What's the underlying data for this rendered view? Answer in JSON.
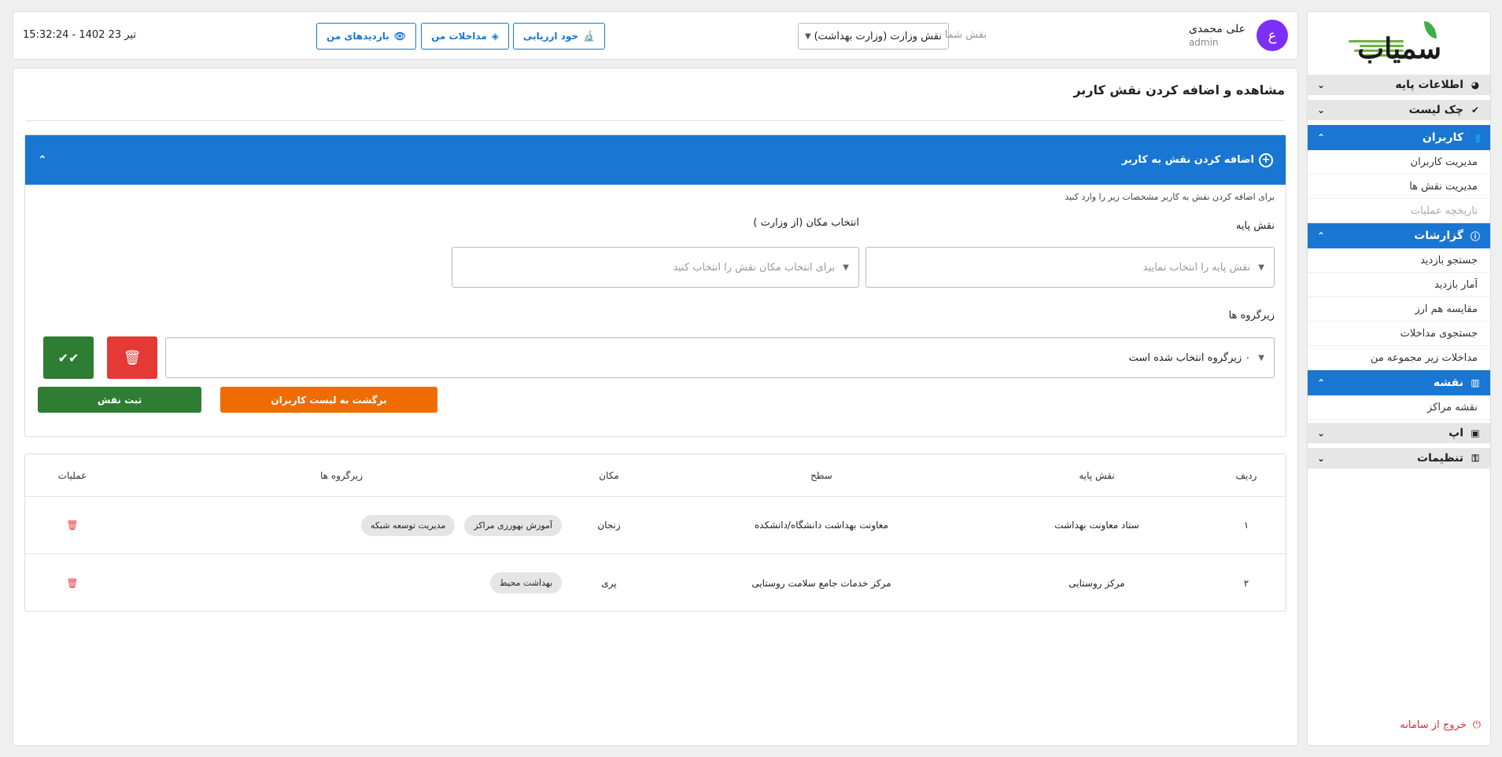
{
  "sidebar": {
    "logo_text": "سمیاب",
    "groups": [
      {
        "label": "اطلاعات پایه",
        "icon": "pie-chart-icon",
        "expanded": false
      },
      {
        "label": "چک لیست",
        "icon": "check-circle-icon",
        "expanded": false
      },
      {
        "label": "کاربران",
        "icon": "users-icon",
        "expanded": true,
        "items": [
          "مدیریت کاربران",
          "مدیریت نقش ها",
          "تاریخچه عملیات"
        ]
      },
      {
        "label": "گزارشات",
        "icon": "alert-circle-icon",
        "expanded": true,
        "items": [
          "جستجو بازدید",
          "آمار بازدید",
          "مقایسه هم ارز",
          "جستجوی مداخلات",
          "مداخلات زیر مجموعه من"
        ]
      },
      {
        "label": "نقشه",
        "icon": "map-icon",
        "expanded": true,
        "items": [
          "نقشه مراکز"
        ]
      },
      {
        "label": "اپ",
        "icon": "app-icon",
        "expanded": false
      },
      {
        "label": "تنظیمات",
        "icon": "key-icon",
        "expanded": false
      }
    ],
    "logout": "خروج از سامانه"
  },
  "header": {
    "user_initial": "ع",
    "user_name": "علی محمدی",
    "user_role": "admin",
    "role_label": "نقش شما",
    "role_value": "نقش وزارت (وزارت بهداشت)",
    "buttons": {
      "self_eval": "خود ارزیابی",
      "interventions": "مداخلات من",
      "visits": "بازدیدهای من"
    },
    "datetime": "15:32:24 - 1402 تیر 23"
  },
  "page": {
    "title": "مشاهده و اضافه کردن نقش کاربر",
    "panel": {
      "title": "اضافه کردن نقش به کاربر",
      "hint": "برای اضافه کردن نقش به کاربر مشخصات زیر را وارد کنید",
      "base_role_label": "نقش پایه",
      "base_role_placeholder": "نقش پایه را انتخاب نمایید",
      "location_label": "انتخاب مکان (از وزارت )",
      "location_placeholder": "برای انتخاب مکان نقش را انتخاب کنید",
      "subgroups_label": "زیرگروه ها",
      "subgroups_value": "۰ زیرگروه انتخاب شده است",
      "back_button": "برگشت به لیست کاربران",
      "submit_button": "ثبت نقش"
    },
    "table": {
      "headers": {
        "index": "ردیف",
        "base_role": "نقش پایه",
        "level": "سطح",
        "location": "مکان",
        "subgroups": "زیرگروه ها",
        "actions": "عملیات"
      },
      "rows": [
        {
          "index": "۱",
          "base_role": "ستاد معاونت بهداشت",
          "level": "معاونت بهداشت دانشگاه/دانشکده",
          "location": "زنجان",
          "subgroups": [
            "آموزش بهورزی مراکز",
            "مدیریت توسعه شبکه"
          ]
        },
        {
          "index": "۲",
          "base_role": "مرکز روستایی",
          "level": "مرکز خدمات جامع سلامت روستایی",
          "location": "پری",
          "subgroups": [
            "بهداشت محیط"
          ]
        }
      ]
    }
  },
  "colors": {
    "primary": "#1976d2",
    "success": "#2e7d32",
    "danger": "#d32f2f",
    "warning": "#ef6c00",
    "avatar": "#7b2ff7"
  }
}
